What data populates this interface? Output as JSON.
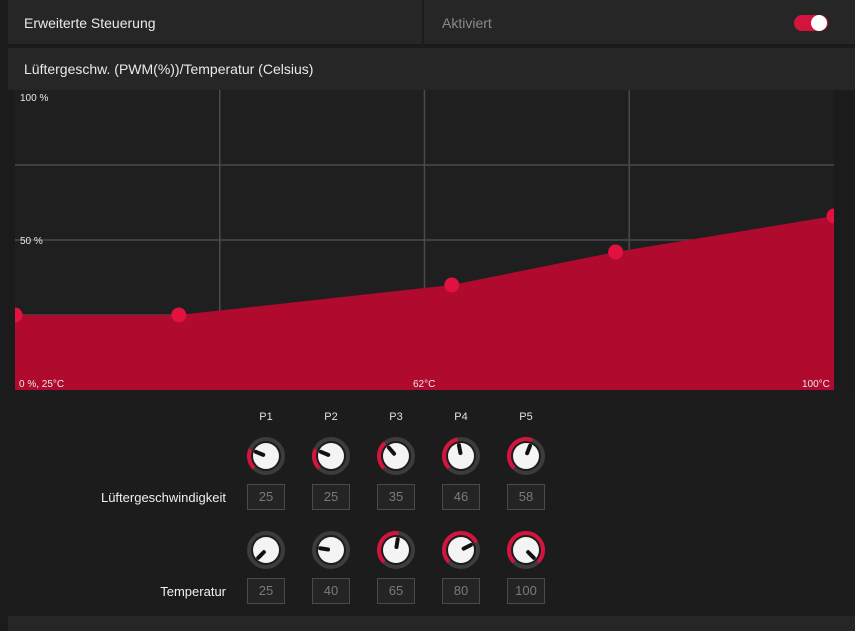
{
  "header": {
    "title": "Erweiterte Steuerung",
    "status": "Aktiviert",
    "toggle_on": true
  },
  "graph": {
    "title": "Lüftergeschw. (PWM(%))/Temperatur (Celsius)",
    "y_label_top": "100 %",
    "y_label_mid": "50 %",
    "x_label_left": "0 %, 25°C",
    "x_label_mid": "62°C",
    "x_label_right": "100°C"
  },
  "chart_data": {
    "type": "area",
    "x": [
      25,
      40,
      65,
      80,
      100
    ],
    "y": [
      25,
      25,
      35,
      46,
      58
    ],
    "xlim": [
      25,
      100
    ],
    "ylim": [
      0,
      100
    ],
    "fill_color": "#b00a2e",
    "point_color": "#e3113f",
    "grid": true
  },
  "controls": {
    "columns": [
      "P1",
      "P2",
      "P3",
      "P4",
      "P5"
    ],
    "fan_label": "Lüftergeschwindigkeit",
    "temp_label": "Temperatur",
    "fan_values": [
      "25",
      "25",
      "35",
      "46",
      "58"
    ],
    "temp_values": [
      "25",
      "40",
      "65",
      "80",
      "100"
    ]
  },
  "colors": {
    "accent": "#d4143c",
    "background": "#1b1b1b",
    "panel": "#262626"
  }
}
